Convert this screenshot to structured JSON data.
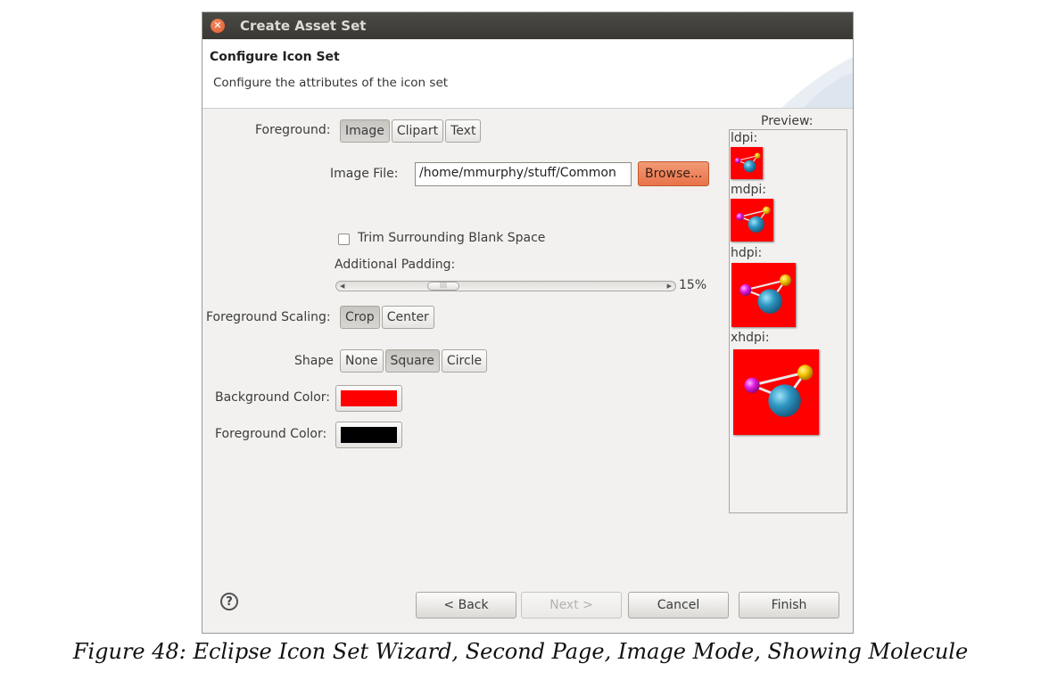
{
  "window": {
    "title": "Create Asset Set"
  },
  "header": {
    "title": "Configure Icon Set",
    "description": "Configure the attributes of the icon set"
  },
  "form": {
    "foreground": {
      "label": "Foreground:",
      "options": [
        "Image",
        "Clipart",
        "Text"
      ],
      "selected": "Image"
    },
    "image_file": {
      "label": "Image File:",
      "value": "/home/mmurphy/stuff/Common",
      "browse_label": "Browse..."
    },
    "trim": {
      "label": "Trim Surrounding Blank Space",
      "checked": false
    },
    "padding": {
      "label": "Additional Padding:",
      "value_text": "15%",
      "value": 15
    },
    "scaling": {
      "label": "Foreground Scaling:",
      "options": [
        "Crop",
        "Center"
      ],
      "selected": "Crop"
    },
    "shape": {
      "label": "Shape",
      "options": [
        "None",
        "Square",
        "Circle"
      ],
      "selected": "Square"
    },
    "background_color": {
      "label": "Background Color:",
      "color": "#ff0000"
    },
    "foreground_color": {
      "label": "Foreground Color:",
      "color": "#000000"
    }
  },
  "preview": {
    "label": "Preview:",
    "densities": [
      "ldpi:",
      "mdpi:",
      "hdpi:",
      "xhdpi:"
    ],
    "icon_background": "#ff0000"
  },
  "footer": {
    "help_label": "?",
    "back_label": "< Back",
    "next_label": "Next >",
    "cancel_label": "Cancel",
    "finish_label": "Finish"
  },
  "caption": "Figure 48: Eclipse Icon Set Wizard, Second Page, Image Mode, Showing Molecule"
}
